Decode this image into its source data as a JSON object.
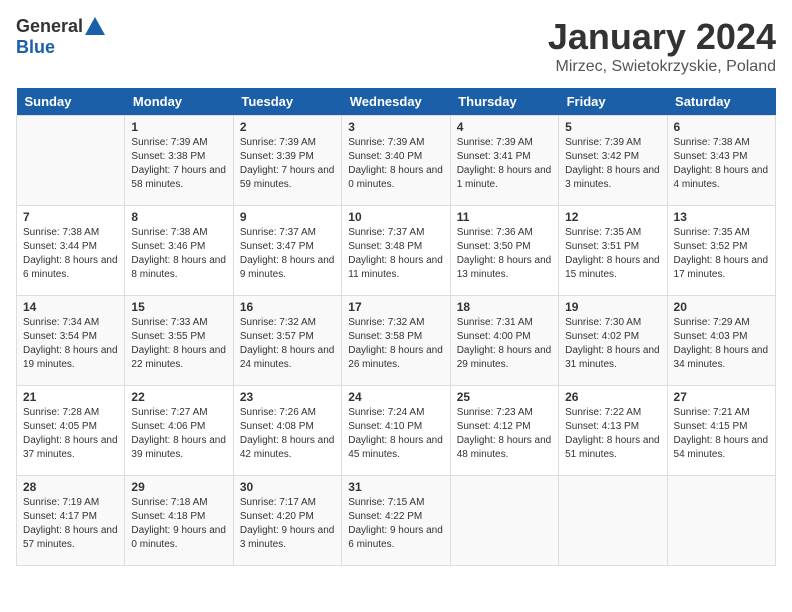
{
  "header": {
    "logo_general": "General",
    "logo_blue": "Blue",
    "title": "January 2024",
    "location": "Mirzec, Swietokrzyskie, Poland"
  },
  "days_of_week": [
    "Sunday",
    "Monday",
    "Tuesday",
    "Wednesday",
    "Thursday",
    "Friday",
    "Saturday"
  ],
  "weeks": [
    [
      {
        "day": "",
        "sunrise": "",
        "sunset": "",
        "daylight": ""
      },
      {
        "day": "1",
        "sunrise": "Sunrise: 7:39 AM",
        "sunset": "Sunset: 3:38 PM",
        "daylight": "Daylight: 7 hours and 58 minutes."
      },
      {
        "day": "2",
        "sunrise": "Sunrise: 7:39 AM",
        "sunset": "Sunset: 3:39 PM",
        "daylight": "Daylight: 7 hours and 59 minutes."
      },
      {
        "day": "3",
        "sunrise": "Sunrise: 7:39 AM",
        "sunset": "Sunset: 3:40 PM",
        "daylight": "Daylight: 8 hours and 0 minutes."
      },
      {
        "day": "4",
        "sunrise": "Sunrise: 7:39 AM",
        "sunset": "Sunset: 3:41 PM",
        "daylight": "Daylight: 8 hours and 1 minute."
      },
      {
        "day": "5",
        "sunrise": "Sunrise: 7:39 AM",
        "sunset": "Sunset: 3:42 PM",
        "daylight": "Daylight: 8 hours and 3 minutes."
      },
      {
        "day": "6",
        "sunrise": "Sunrise: 7:38 AM",
        "sunset": "Sunset: 3:43 PM",
        "daylight": "Daylight: 8 hours and 4 minutes."
      }
    ],
    [
      {
        "day": "7",
        "sunrise": "Sunrise: 7:38 AM",
        "sunset": "Sunset: 3:44 PM",
        "daylight": "Daylight: 8 hours and 6 minutes."
      },
      {
        "day": "8",
        "sunrise": "Sunrise: 7:38 AM",
        "sunset": "Sunset: 3:46 PM",
        "daylight": "Daylight: 8 hours and 8 minutes."
      },
      {
        "day": "9",
        "sunrise": "Sunrise: 7:37 AM",
        "sunset": "Sunset: 3:47 PM",
        "daylight": "Daylight: 8 hours and 9 minutes."
      },
      {
        "day": "10",
        "sunrise": "Sunrise: 7:37 AM",
        "sunset": "Sunset: 3:48 PM",
        "daylight": "Daylight: 8 hours and 11 minutes."
      },
      {
        "day": "11",
        "sunrise": "Sunrise: 7:36 AM",
        "sunset": "Sunset: 3:50 PM",
        "daylight": "Daylight: 8 hours and 13 minutes."
      },
      {
        "day": "12",
        "sunrise": "Sunrise: 7:35 AM",
        "sunset": "Sunset: 3:51 PM",
        "daylight": "Daylight: 8 hours and 15 minutes."
      },
      {
        "day": "13",
        "sunrise": "Sunrise: 7:35 AM",
        "sunset": "Sunset: 3:52 PM",
        "daylight": "Daylight: 8 hours and 17 minutes."
      }
    ],
    [
      {
        "day": "14",
        "sunrise": "Sunrise: 7:34 AM",
        "sunset": "Sunset: 3:54 PM",
        "daylight": "Daylight: 8 hours and 19 minutes."
      },
      {
        "day": "15",
        "sunrise": "Sunrise: 7:33 AM",
        "sunset": "Sunset: 3:55 PM",
        "daylight": "Daylight: 8 hours and 22 minutes."
      },
      {
        "day": "16",
        "sunrise": "Sunrise: 7:32 AM",
        "sunset": "Sunset: 3:57 PM",
        "daylight": "Daylight: 8 hours and 24 minutes."
      },
      {
        "day": "17",
        "sunrise": "Sunrise: 7:32 AM",
        "sunset": "Sunset: 3:58 PM",
        "daylight": "Daylight: 8 hours and 26 minutes."
      },
      {
        "day": "18",
        "sunrise": "Sunrise: 7:31 AM",
        "sunset": "Sunset: 4:00 PM",
        "daylight": "Daylight: 8 hours and 29 minutes."
      },
      {
        "day": "19",
        "sunrise": "Sunrise: 7:30 AM",
        "sunset": "Sunset: 4:02 PM",
        "daylight": "Daylight: 8 hours and 31 minutes."
      },
      {
        "day": "20",
        "sunrise": "Sunrise: 7:29 AM",
        "sunset": "Sunset: 4:03 PM",
        "daylight": "Daylight: 8 hours and 34 minutes."
      }
    ],
    [
      {
        "day": "21",
        "sunrise": "Sunrise: 7:28 AM",
        "sunset": "Sunset: 4:05 PM",
        "daylight": "Daylight: 8 hours and 37 minutes."
      },
      {
        "day": "22",
        "sunrise": "Sunrise: 7:27 AM",
        "sunset": "Sunset: 4:06 PM",
        "daylight": "Daylight: 8 hours and 39 minutes."
      },
      {
        "day": "23",
        "sunrise": "Sunrise: 7:26 AM",
        "sunset": "Sunset: 4:08 PM",
        "daylight": "Daylight: 8 hours and 42 minutes."
      },
      {
        "day": "24",
        "sunrise": "Sunrise: 7:24 AM",
        "sunset": "Sunset: 4:10 PM",
        "daylight": "Daylight: 8 hours and 45 minutes."
      },
      {
        "day": "25",
        "sunrise": "Sunrise: 7:23 AM",
        "sunset": "Sunset: 4:12 PM",
        "daylight": "Daylight: 8 hours and 48 minutes."
      },
      {
        "day": "26",
        "sunrise": "Sunrise: 7:22 AM",
        "sunset": "Sunset: 4:13 PM",
        "daylight": "Daylight: 8 hours and 51 minutes."
      },
      {
        "day": "27",
        "sunrise": "Sunrise: 7:21 AM",
        "sunset": "Sunset: 4:15 PM",
        "daylight": "Daylight: 8 hours and 54 minutes."
      }
    ],
    [
      {
        "day": "28",
        "sunrise": "Sunrise: 7:19 AM",
        "sunset": "Sunset: 4:17 PM",
        "daylight": "Daylight: 8 hours and 57 minutes."
      },
      {
        "day": "29",
        "sunrise": "Sunrise: 7:18 AM",
        "sunset": "Sunset: 4:18 PM",
        "daylight": "Daylight: 9 hours and 0 minutes."
      },
      {
        "day": "30",
        "sunrise": "Sunrise: 7:17 AM",
        "sunset": "Sunset: 4:20 PM",
        "daylight": "Daylight: 9 hours and 3 minutes."
      },
      {
        "day": "31",
        "sunrise": "Sunrise: 7:15 AM",
        "sunset": "Sunset: 4:22 PM",
        "daylight": "Daylight: 9 hours and 6 minutes."
      },
      {
        "day": "",
        "sunrise": "",
        "sunset": "",
        "daylight": ""
      },
      {
        "day": "",
        "sunrise": "",
        "sunset": "",
        "daylight": ""
      },
      {
        "day": "",
        "sunrise": "",
        "sunset": "",
        "daylight": ""
      }
    ]
  ]
}
